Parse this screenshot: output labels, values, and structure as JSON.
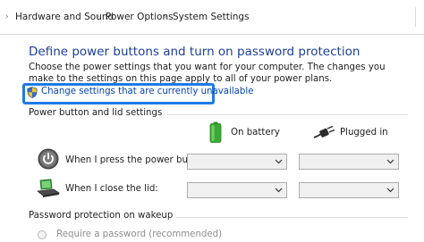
{
  "breadcrumb": {
    "items": [
      "Hardware and Sound",
      "Power Options",
      "System Settings"
    ],
    "separator": "›"
  },
  "main": {
    "title": "Define power buttons and turn on password protection",
    "description": "Choose the power settings that you want for your computer. The changes you make to the settings on this page apply to all of your power plans.",
    "change_settings_link": "Change settings that are currently unavailable",
    "highlight_color": "#1e7ae6"
  },
  "power_section": {
    "label": "Power button and lid settings",
    "columns": {
      "battery": "On battery",
      "plugged": "Plugged in"
    },
    "rows": [
      {
        "label": "When I press the power button:",
        "icon": "power-button-icon",
        "battery_value": "",
        "plugged_value": ""
      },
      {
        "label": "When I close the lid:",
        "icon": "laptop-lid-icon",
        "battery_value": "",
        "plugged_value": ""
      }
    ]
  },
  "password_section": {
    "label": "Password protection on wakeup",
    "option_require": "Require a password (recommended)"
  },
  "colors": {
    "title": "#1c3f95",
    "link": "#0645ad",
    "battery_green": "#3aa935"
  }
}
